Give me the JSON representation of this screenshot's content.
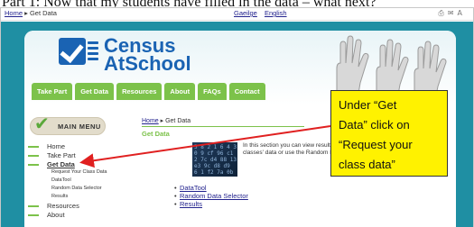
{
  "slide_title": "Part 1: Now that my students have filled in the data – what next?",
  "browser_bar": {
    "crumb_home": "Home",
    "crumb_sep": " ▸ ",
    "crumb_current": "Get Data",
    "languages": [
      "Gaeilge",
      "English"
    ],
    "icons": [
      "print-icon",
      "email-icon",
      "font-size-icon"
    ]
  },
  "logo": {
    "line1": "Census",
    "line2": "AtSchool"
  },
  "nav_tabs": [
    "Take Part",
    "Get Data",
    "Resources",
    "About",
    "FAQs",
    "Contact"
  ],
  "sidebar": {
    "title": "MAIN MENU",
    "items_top": [
      "Home",
      "Take Part",
      "Get Data"
    ],
    "sub_items": [
      "Request Your Class Data",
      "DataTool",
      "Random Data Selector",
      "Results"
    ],
    "items_bottom": [
      "Resources",
      "About"
    ]
  },
  "content": {
    "bc_home": "Home",
    "bc_sep": " ▸ ",
    "bc_current": "Get Data",
    "heading": "Get Data",
    "intro": "In this section you can view results from your classes' data or use the Random Data",
    "photo_rows": [
      "5 8 2 1 6 4 3",
      "0 9 cf 96 c1",
      "2 7c d4 88 13",
      "e3 9c d8 d9",
      "6 1 f2 7a 0b"
    ],
    "links": [
      "DataTool",
      "Random Data Selector",
      "Results"
    ]
  },
  "callout": {
    "lines": [
      "Under “Get",
      "Data” click on",
      "“Request your",
      "class data”"
    ]
  },
  "colors": {
    "teal_bg": "#1f8fa3",
    "nav_green": "#7cc24a",
    "logo_blue": "#1a63b3",
    "callout_yellow": "#fff200",
    "arrow_red": "#e02020"
  }
}
